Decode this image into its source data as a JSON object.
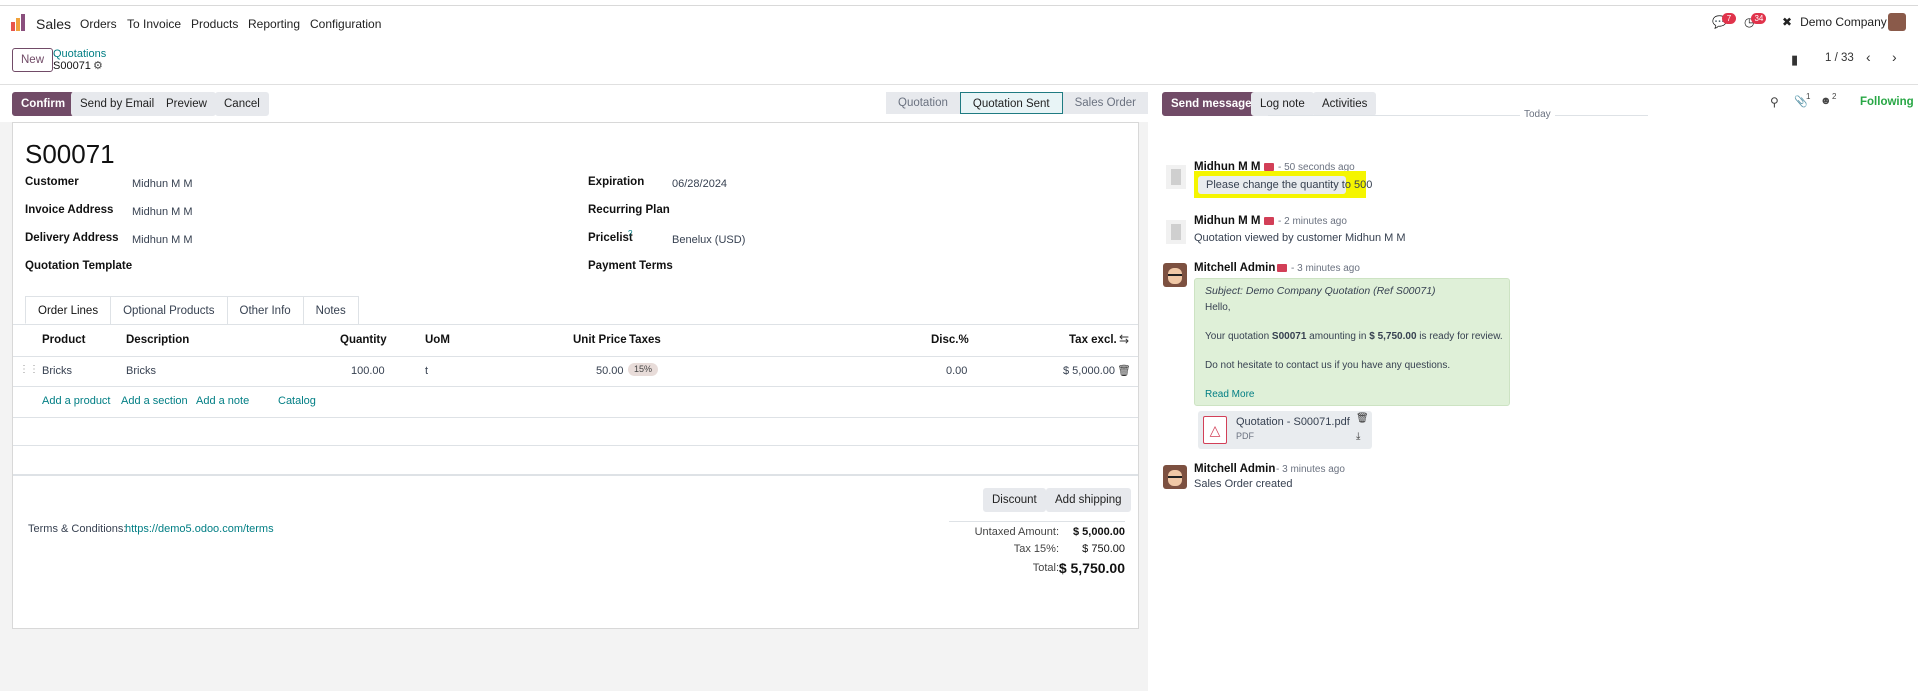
{
  "navbar": {
    "app_name": "Sales",
    "menu": [
      "Orders",
      "To Invoice",
      "Products",
      "Reporting",
      "Configuration"
    ],
    "messages_badge": "7",
    "activities_badge": "34",
    "company": "Demo Company"
  },
  "control": {
    "new_label": "New",
    "breadcrumb_parent": "Quotations",
    "breadcrumb_current": "S00071",
    "pager": "1 / 33"
  },
  "actions": {
    "confirm": "Confirm",
    "send_email": "Send by Email",
    "preview": "Preview",
    "cancel": "Cancel"
  },
  "status": {
    "stages": [
      "Quotation",
      "Quotation Sent",
      "Sales Order"
    ],
    "active_index": 1
  },
  "form": {
    "name": "S00071",
    "customer_label": "Customer",
    "customer": "Midhun M M",
    "invoice_label": "Invoice Address",
    "invoice": "Midhun M M",
    "delivery_label": "Delivery Address",
    "delivery": "Midhun M M",
    "template_label": "Quotation Template",
    "expiration_label": "Expiration",
    "expiration": "06/28/2024",
    "recurring_label": "Recurring Plan",
    "pricelist_label": "Pricelist",
    "pricelist_help": "?",
    "pricelist": "Benelux (USD)",
    "payment_label": "Payment Terms"
  },
  "tabs": [
    "Order Lines",
    "Optional Products",
    "Other Info",
    "Notes"
  ],
  "lines": {
    "headers": {
      "product": "Product",
      "description": "Description",
      "quantity": "Quantity",
      "uom": "UoM",
      "unit_price": "Unit Price",
      "taxes": "Taxes",
      "disc": "Disc.%",
      "tax_excl": "Tax excl."
    },
    "rows": [
      {
        "product": "Bricks",
        "description": "Bricks",
        "quantity": "100.00",
        "uom": "t",
        "unit_price": "50.00",
        "tax": "15%",
        "disc": "0.00",
        "subtotal": "$ 5,000.00"
      }
    ],
    "add_product": "Add a product",
    "add_section": "Add a section",
    "add_note": "Add a note",
    "catalog": "Catalog"
  },
  "footer": {
    "discount": "Discount",
    "add_shipping": "Add shipping",
    "terms_label": "Terms & Conditions:",
    "terms_link": "https://demo5.odoo.com/terms",
    "untaxed_label": "Untaxed Amount:",
    "untaxed": "$ 5,000.00",
    "tax_label": "Tax 15%:",
    "tax": "$ 750.00",
    "total_label": "Total:",
    "total": "$ 5,750.00"
  },
  "chatter": {
    "send_message": "Send message",
    "log_note": "Log note",
    "activities": "Activities",
    "attachments_count": "1",
    "followers_count": "2",
    "following": "Following",
    "today": "Today",
    "messages": [
      {
        "author": "Midhun M M",
        "meta": "- 50 seconds ago",
        "body": "Please change the quantity to 500"
      },
      {
        "author": "Midhun M M",
        "meta": "- 2 minutes ago",
        "body": "Quotation viewed by customer Midhun M M"
      },
      {
        "author": "Mitchell Admin",
        "meta": "- 3 minutes ago",
        "subject": "Subject: Demo Company Quotation (Ref S00071)",
        "hello": "Hello,",
        "line1_a": "Your quotation ",
        "line1_b": "S00071",
        "line1_c": " amounting in ",
        "line1_d": "$ 5,750.00",
        "line1_e": " is ready for review.",
        "line2": "Do not hesitate to contact us if you have any questions.",
        "read_more": "Read More",
        "attachment_name": "Quotation - S00071.pdf",
        "attachment_type": "PDF"
      },
      {
        "author": "Mitchell Admin",
        "meta": "- 3 minutes ago",
        "body": "Sales Order created"
      }
    ]
  },
  "colors": {
    "primary": "#714b67",
    "link": "#017e84",
    "highlight": "#f5f500",
    "email_bg": "#dff0d8"
  }
}
